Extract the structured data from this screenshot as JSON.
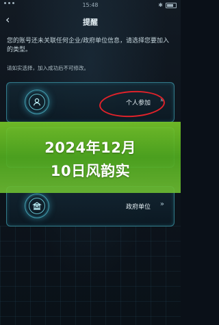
{
  "status_bar": {
    "time": "15:48",
    "signal": "..."
  },
  "nav": {
    "back": "‹",
    "title": "提醒"
  },
  "notice": "您的账号还未关联任何企业/政府单位信息，请选择您要加入的类型。",
  "hint": "请如实选择，加入成功后不可修改。",
  "options": [
    {
      "label": "个人参加",
      "chevron": "»",
      "icon": "person-icon"
    },
    {
      "label": "政府单位",
      "chevron": "»",
      "icon": "government-building-icon"
    }
  ],
  "banner": {
    "line1": "2024年12月",
    "line2": "10日风韵实"
  },
  "colors": {
    "accent": "#50c8dc",
    "highlight": "#e0222a",
    "banner": "#7ac02a"
  }
}
